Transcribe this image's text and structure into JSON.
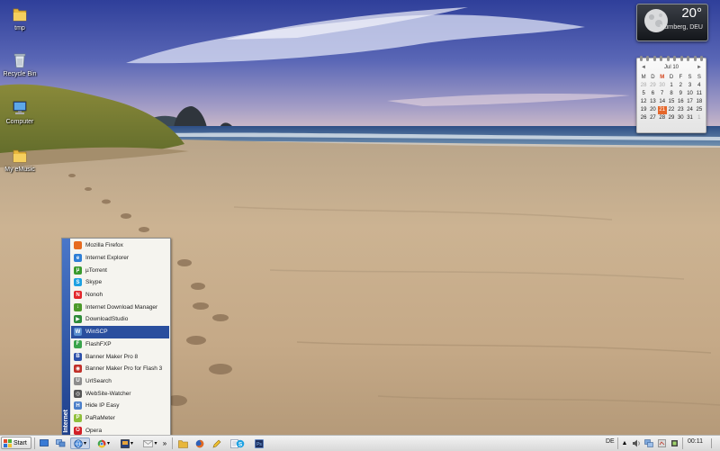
{
  "desktop": {
    "icons": [
      {
        "label": "tmp",
        "icon": "folder-icon"
      },
      {
        "label": "Recycle Bin",
        "icon": "recycle-bin-icon"
      },
      {
        "label": "Computer",
        "icon": "computer-icon"
      },
      {
        "label": "My eMusic",
        "icon": "folder-icon"
      }
    ]
  },
  "weather": {
    "temperature": "20°",
    "location": "Nürnberg, DEU",
    "icon": "moon-icon"
  },
  "calendar": {
    "month_label": "Jul 10",
    "prev_label": "◄",
    "next_label": "►",
    "weekdays": [
      "M",
      "D",
      "M",
      "D",
      "F",
      "S",
      "S"
    ],
    "today_weekday_index": 2,
    "days": [
      {
        "d": "28",
        "other": true
      },
      {
        "d": "29",
        "other": true
      },
      {
        "d": "30",
        "other": true
      },
      {
        "d": "1"
      },
      {
        "d": "2"
      },
      {
        "d": "3"
      },
      {
        "d": "4"
      },
      {
        "d": "5"
      },
      {
        "d": "6"
      },
      {
        "d": "7"
      },
      {
        "d": "8"
      },
      {
        "d": "9"
      },
      {
        "d": "10"
      },
      {
        "d": "11"
      },
      {
        "d": "12"
      },
      {
        "d": "13"
      },
      {
        "d": "14"
      },
      {
        "d": "15"
      },
      {
        "d": "16"
      },
      {
        "d": "17"
      },
      {
        "d": "18"
      },
      {
        "d": "19"
      },
      {
        "d": "20"
      },
      {
        "d": "21",
        "today": true
      },
      {
        "d": "22"
      },
      {
        "d": "23"
      },
      {
        "d": "24"
      },
      {
        "d": "25"
      },
      {
        "d": "26"
      },
      {
        "d": "27"
      },
      {
        "d": "28"
      },
      {
        "d": "29"
      },
      {
        "d": "30"
      },
      {
        "d": "31"
      },
      {
        "d": "1",
        "other": true
      }
    ]
  },
  "launch_menu": {
    "side_label": "Internet",
    "selected_index": 7,
    "items": [
      {
        "label": "Mozilla Firefox",
        "icon": "firefox-icon",
        "color": "#e66a1f",
        "glyph": ""
      },
      {
        "label": "Internet Explorer",
        "icon": "internet-explorer-icon",
        "color": "#2f7fd6",
        "glyph": "e"
      },
      {
        "label": "µTorrent",
        "icon": "utorrent-icon",
        "color": "#3a9b2f",
        "glyph": "µ"
      },
      {
        "label": "Skype",
        "icon": "skype-icon",
        "color": "#1da1e2",
        "glyph": "S"
      },
      {
        "label": "Nonoh",
        "icon": "nonoh-icon",
        "color": "#e2262a",
        "glyph": "N"
      },
      {
        "label": "Internet Download Manager",
        "icon": "download-manager-icon",
        "color": "#4c9a2a",
        "glyph": "↓"
      },
      {
        "label": "DownloadStudio",
        "icon": "downloadstudio-icon",
        "color": "#2e8b3a",
        "glyph": "▶"
      },
      {
        "label": "WinSCP",
        "icon": "winscp-icon",
        "color": "#5a8fd0",
        "glyph": "W"
      },
      {
        "label": "FlashFXP",
        "icon": "flashfxp-icon",
        "color": "#3aa34b",
        "glyph": "F"
      },
      {
        "label": "Banner Maker Pro 8",
        "icon": "banner-maker-icon",
        "color": "#2c4fa8",
        "glyph": "B"
      },
      {
        "label": "Banner Maker Pro for Flash 3",
        "icon": "banner-maker-flash-icon",
        "color": "#c0302a",
        "glyph": "◉"
      },
      {
        "label": "UrlSearch",
        "icon": "urlsearch-icon",
        "color": "#8d8d8d",
        "glyph": "U"
      },
      {
        "label": "WebSite-Watcher",
        "icon": "website-watcher-icon",
        "color": "#555555",
        "glyph": "◎"
      },
      {
        "label": "Hide IP Easy",
        "icon": "hide-ip-icon",
        "color": "#4b7fc9",
        "glyph": "H"
      },
      {
        "label": "PaRaMeter",
        "icon": "parameter-icon",
        "color": "#8fbf3a",
        "glyph": "P"
      },
      {
        "label": "Opera",
        "icon": "opera-icon",
        "color": "#d21f26",
        "glyph": "O"
      }
    ]
  },
  "taskbar": {
    "start_label": "Start",
    "chevron_label": "»",
    "language": "DE",
    "time": "00:11",
    "colors": {
      "accent": "#2a4f9e"
    }
  }
}
